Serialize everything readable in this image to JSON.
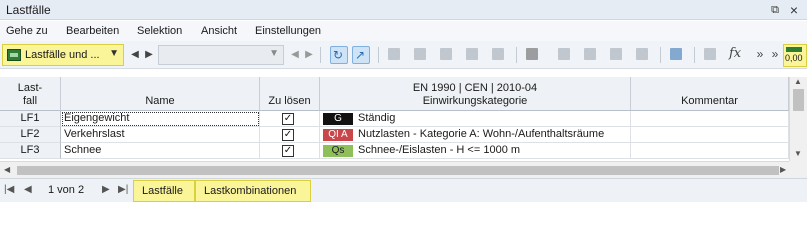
{
  "window": {
    "title": "Lastfälle",
    "restore_icon": "⧉",
    "close_icon": "×"
  },
  "menu": [
    "Gehe zu",
    "Bearbeiten",
    "Selektion",
    "Ansicht",
    "Einstellungen"
  ],
  "toolbar": {
    "combo_label": "Lastfälle und ...",
    "fx_label": "fx",
    "value_label": "0,00",
    "more_label": "»",
    "highlight_color": "#fbf59a"
  },
  "table": {
    "headers": {
      "row_header_line1": "Last-",
      "row_header_line2": "fall",
      "name": "Name",
      "solve": "Zu lösen",
      "category_line1": "EN 1990 | CEN | 2010-04",
      "category_line2": "Einwirkungskategorie",
      "comment": "Kommentar"
    },
    "rows": [
      {
        "id": "LF1",
        "name": "Eigengewicht",
        "solve": true,
        "code": "G",
        "code_bg": "#111111",
        "code_fg": "#ffffff",
        "category": "Ständig",
        "comment": ""
      },
      {
        "id": "LF2",
        "name": "Verkehrslast",
        "solve": true,
        "code": "QI A",
        "code_bg": "#c9474b",
        "code_fg": "#ffffff",
        "category": "Nutzlasten - Kategorie A: Wohn-/Aufenthaltsräume",
        "comment": ""
      },
      {
        "id": "LF3",
        "name": "Schnee",
        "solve": true,
        "code": "Qs",
        "code_bg": "#8fbf5a",
        "code_fg": "#1a1a1a",
        "category": "Schnee-/Eislasten - H <= 1000 m",
        "comment": ""
      }
    ]
  },
  "status": {
    "page_info": "1 von 2",
    "tabs": [
      "Lastfälle",
      "Lastkombinationen"
    ]
  }
}
